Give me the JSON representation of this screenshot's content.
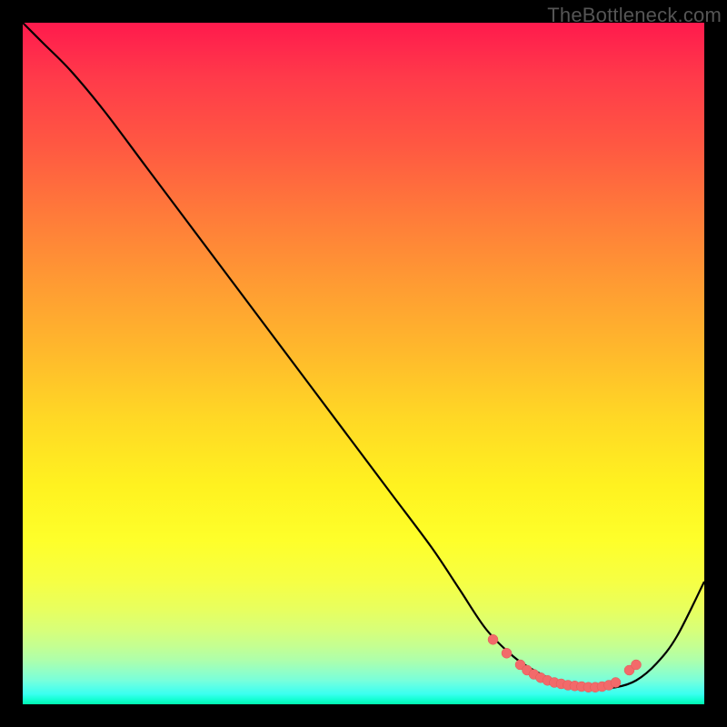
{
  "watermark": "TheBottleneck.com",
  "colors": {
    "curve_stroke": "#000000",
    "marker_fill": "#f26a6a",
    "marker_stroke": "#e05858"
  },
  "chart_data": {
    "type": "line",
    "title": "",
    "xlabel": "",
    "ylabel": "",
    "xlim": [
      0,
      100
    ],
    "ylim": [
      0,
      100
    ],
    "grid": false,
    "series": [
      {
        "name": "curve",
        "x": [
          0,
          3,
          7,
          12,
          18,
          24,
          30,
          36,
          42,
          48,
          54,
          60,
          64,
          68,
          72,
          75,
          78,
          81,
          84,
          87,
          90,
          93,
          96,
          100
        ],
        "y": [
          100,
          97,
          93,
          87,
          79,
          71,
          63,
          55,
          47,
          39,
          31,
          23,
          17,
          11,
          7,
          5,
          3.5,
          2.8,
          2.5,
          2.5,
          3.5,
          6,
          10,
          18
        ]
      }
    ],
    "markers": {
      "name": "flat-region-points",
      "x": [
        69,
        71,
        73,
        74,
        75,
        76,
        77,
        78,
        79,
        80,
        81,
        82,
        83,
        84,
        85,
        86,
        87,
        89,
        90
      ],
      "y": [
        9.5,
        7.5,
        5.8,
        5.0,
        4.4,
        3.9,
        3.5,
        3.2,
        3.0,
        2.8,
        2.7,
        2.6,
        2.5,
        2.5,
        2.6,
        2.8,
        3.2,
        5.0,
        5.8
      ]
    }
  }
}
